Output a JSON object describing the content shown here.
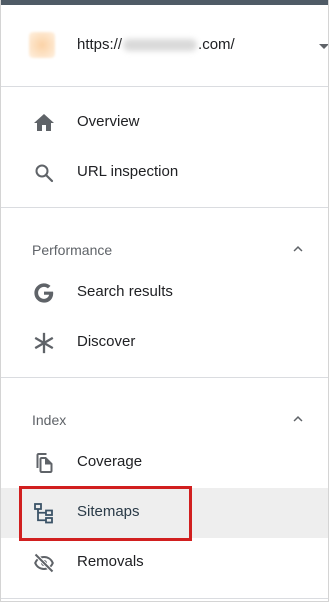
{
  "property": {
    "url_prefix": "https://",
    "url_suffix": ".com/"
  },
  "nav": {
    "overview": "Overview",
    "url_inspection": "URL inspection"
  },
  "performance": {
    "title": "Performance",
    "items": {
      "search_results": "Search results",
      "discover": "Discover"
    }
  },
  "index": {
    "title": "Index",
    "items": {
      "coverage": "Coverage",
      "sitemaps": "Sitemaps",
      "removals": "Removals"
    }
  },
  "selected_item": "Sitemaps",
  "colors": {
    "topbar": "#4f5b66",
    "icon": "#5f6368",
    "selected_bg": "#eeeeee",
    "highlight_box": "#d11f1f"
  },
  "icons": {
    "overview": "home-icon",
    "url_inspection": "search-icon",
    "search_results": "google-g-icon",
    "discover": "asterisk-icon",
    "coverage": "copy-pages-icon",
    "sitemaps": "sitemap-icon",
    "removals": "eye-off-icon"
  }
}
